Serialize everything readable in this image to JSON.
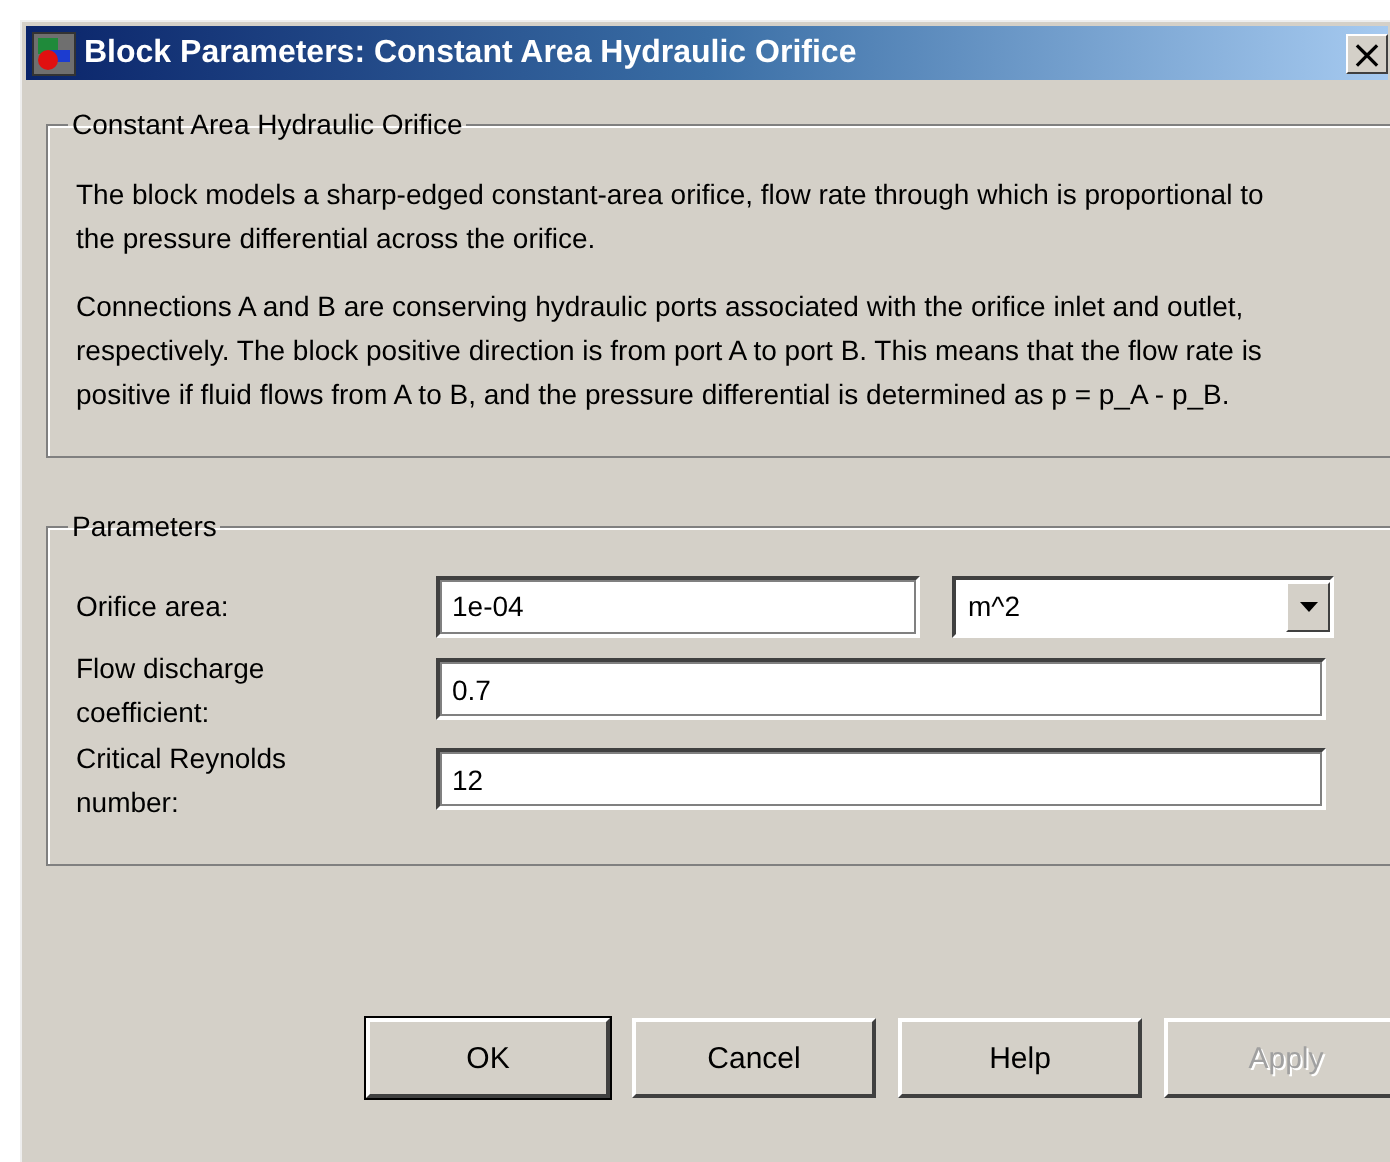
{
  "window": {
    "title": "Block Parameters: Constant Area Hydraulic Orifice",
    "close": "×"
  },
  "description": {
    "title": "Constant Area Hydraulic Orifice",
    "paragraphs": [
      "The block models a sharp-edged constant-area orifice, flow rate through which is proportional to the pressure differential across the orifice.",
      "Connections A and B are conserving hydraulic ports associated with the orifice inlet and outlet, respectively. The block positive direction is from port A to port B. This means that the flow rate is positive if fluid flows from A to B, and the pressure differential is determined as p = p_A - p_B."
    ]
  },
  "parameters": {
    "title": "Parameters",
    "rows": [
      {
        "label": "Orifice area:",
        "value": "1e-04",
        "unit": "m^2"
      },
      {
        "label": "Flow discharge coefficient:",
        "value": "0.7"
      },
      {
        "label": "Critical Reynolds number:",
        "value": "12"
      }
    ]
  },
  "buttons": [
    {
      "label": "OK",
      "default": true,
      "disabled": false
    },
    {
      "label": "Cancel",
      "default": false,
      "disabled": false
    },
    {
      "label": "Help",
      "default": false,
      "disabled": false
    },
    {
      "label": "Apply",
      "default": false,
      "disabled": true
    }
  ]
}
